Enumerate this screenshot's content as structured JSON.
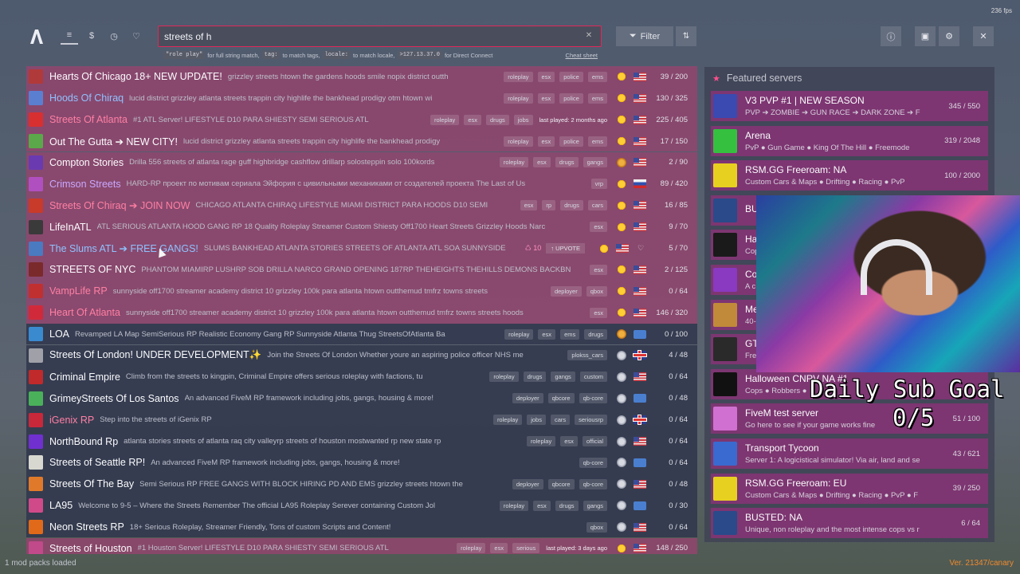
{
  "fps": "236 fps",
  "nav": {
    "icons": [
      "list-icon",
      "dollar-icon",
      "history-icon",
      "heart-icon"
    ]
  },
  "search": {
    "value": "streets of h",
    "placeholder": ""
  },
  "hints": {
    "code1": "\"role play\"",
    "text1": "for full string match,",
    "code2": "tag:",
    "text2": "to match tags,",
    "code3": "locale:",
    "text3": "to match locale,",
    "code4": ">127.13.37.0",
    "text4": "for Direct Connect",
    "cheat": "Cheat sheet"
  },
  "toolbar": {
    "filter_label": "Filter"
  },
  "servers": [
    {
      "name": "Hearts Of Chicago 18+ NEW UPDATE!",
      "desc": "grizzley streets htown the gardens hoods smile nopix district outth",
      "tags": [
        "roleplay",
        "esx",
        "police",
        "ems"
      ],
      "players": "39 / 200",
      "flag": "us",
      "weather": "sun",
      "style": "pink",
      "nameColor": "",
      "icon": "#b03a3a"
    },
    {
      "name": "Hoods Of Chiraq",
      "desc": "lucid district grizzley atlanta streets trappin city highlife the bankhead prodigy otm htown wi",
      "tags": [
        "roleplay",
        "esx",
        "police",
        "ems"
      ],
      "players": "130 / 325",
      "flag": "us",
      "weather": "sun",
      "style": "pink",
      "nameColor": "blue",
      "icon": "#5a7fd0"
    },
    {
      "name": "Streets Of Atlanta",
      "desc": "#1 ATL Server! LIFESTYLE D10 PARA SHIESTY SEMI SERIOUS ATL",
      "tags": [
        "roleplay",
        "esx",
        "drugs",
        "jobs"
      ],
      "lastPlayed": "last played: 2 months ago",
      "players": "225 / 405",
      "flag": "us",
      "weather": "sun",
      "style": "pink",
      "nameColor": "red",
      "icon": "#d83030"
    },
    {
      "name": "Out The Gutta ➔ NEW CITY!",
      "desc": "lucid district grizzley atlanta streets trappin city highlife the bankhead prodigy",
      "tags": [
        "roleplay",
        "esx",
        "police",
        "ems"
      ],
      "players": "17 / 150",
      "flag": "us",
      "weather": "sun",
      "style": "pink",
      "nameColor": "",
      "icon": "#5aa84a"
    },
    {
      "name": "Compton Stories",
      "desc": "Drilla 556 streets of atlanta rage guff highbridge cashflow drillarp solosteppin solo 100kords",
      "tags": [
        "roleplay",
        "esx",
        "drugs",
        "gangs"
      ],
      "players": "2 / 90",
      "flag": "us",
      "weather": "moon",
      "style": "pink",
      "nameColor": "",
      "icon": "#6a3ab0"
    },
    {
      "name": "Crimson Streets",
      "desc": "HARD-RP проект по мотивам сериала Эйфория с цивильными механиками от создателей проекта The Last of Us",
      "tags": [
        "vrp"
      ],
      "players": "89 / 420",
      "flag": "ru",
      "weather": "sun",
      "style": "pink",
      "nameColor": "violet",
      "icon": "#b050c0"
    },
    {
      "name": "Streets Of Chiraq ➔ JOIN NOW",
      "desc": "CHICAGO ATLANTA CHIRAQ LIFESTYLE MIAMI DISTRICT PARA HOODS D10 SEMI",
      "tags": [
        "esx",
        "rp",
        "drugs",
        "cars"
      ],
      "players": "16 / 85",
      "flag": "us",
      "weather": "sun",
      "style": "pink",
      "nameColor": "red",
      "icon": "#c83a2a"
    },
    {
      "name": "LifeInATL",
      "desc": "ATL SERIOUS ATLANTA HOOD GANG RP 18 Quality Roleplay Streamer Custom Shiesty Off1700 Heart Streets Grizzley Hoods Narc",
      "tags": [
        "esx"
      ],
      "players": "9 / 70",
      "flag": "us",
      "weather": "sun",
      "style": "pink",
      "nameColor": "",
      "icon": "#3a3a3a"
    },
    {
      "name": "The Slums ATL ➔ FREE GANGS!",
      "desc": "SLUMS BANKHEAD ATLANTA STORIES STREETS OF ATLANTA ATL SOA SUNNYSIDE",
      "tags": [],
      "boost": "10",
      "upvote": "UPVOTE",
      "heart": true,
      "players": "5 / 70",
      "flag": "us",
      "weather": "sun",
      "style": "pink",
      "nameColor": "blue",
      "icon": "#4a7ac0"
    },
    {
      "name": "STREETS OF NYC",
      "desc": "PHANTOM MIAMIRP LUSHRP SOB DRILLA NARCO GRAND OPENING 187RP THEHEIGHTS THEHILLS DEMONS BACKBN",
      "tags": [
        "esx"
      ],
      "players": "2 / 125",
      "flag": "us",
      "weather": "sun",
      "style": "pink",
      "nameColor": "",
      "icon": "#7a2a2a"
    },
    {
      "name": "VampLife RP",
      "desc": "sunnyside off1700 streamer academy district 10 grizzley 100k para atlanta htown outthemud tmfrz towns streets",
      "tags": [
        "deployer",
        "qbox"
      ],
      "players": "0 / 64",
      "flag": "us",
      "weather": "sun",
      "style": "pink",
      "nameColor": "red",
      "icon": "#c03030"
    },
    {
      "name": "Heart Of Atlanta",
      "desc": "sunnyside off1700 streamer academy district 10 grizzley 100k para atlanta htown outthemud tmfrz towns streets hoods",
      "tags": [
        "esx"
      ],
      "players": "146 / 320",
      "flag": "us",
      "weather": "sun",
      "style": "pink",
      "nameColor": "red",
      "icon": "#d02a3a"
    },
    {
      "name": "LOA",
      "desc": "Revamped LA Map SemiSerious RP Realistic Economy Gang RP Sunnyside Atlanta Thug StreetsOfAtlanta Ba",
      "tags": [
        "roleplay",
        "esx",
        "ems",
        "drugs"
      ],
      "players": "0 / 100",
      "flag": "globe",
      "weather": "moon",
      "style": "dark",
      "nameColor": "",
      "icon": "#3a8ad0"
    },
    {
      "name": "Streets Of London! UNDER DEVELOPMENT✨",
      "desc": "Join the Streets Of London Whether youre an aspiring police officer NHS me",
      "tags": [
        "plokss_cars"
      ],
      "players": "4 / 48",
      "flag": "gb",
      "weather": "night",
      "style": "dark",
      "nameColor": "",
      "icon": "#a0a0a8"
    },
    {
      "name": "Criminal Empire",
      "desc": "Climb from the streets to kingpin, Criminal Empire offers serious roleplay with factions, tu",
      "tags": [
        "roleplay",
        "drugs",
        "gangs",
        "custom"
      ],
      "players": "0 / 64",
      "flag": "us",
      "weather": "night",
      "style": "dark",
      "nameColor": "",
      "icon": "#c02a2a"
    },
    {
      "name": "GrimeyStreets Of Los Santos",
      "desc": "An advanced FiveM RP framework including jobs, gangs, housing & more!",
      "tags": [
        "deployer",
        "qbcore",
        "qb-core"
      ],
      "players": "0 / 48",
      "flag": "globe",
      "weather": "night",
      "style": "dark",
      "nameColor": "",
      "icon": "#4ab05a"
    },
    {
      "name": "iGenix RP",
      "desc": "Step into the streets of iGenix RP",
      "tags": [
        "roleplay",
        "jobs",
        "cars",
        "seriousrp"
      ],
      "players": "0 / 64",
      "flag": "gb",
      "weather": "night",
      "style": "dark",
      "nameColor": "red",
      "icon": "#c8283a"
    },
    {
      "name": "NorthBound Rp",
      "desc": "atlanta stories streets of atlanta raq city valleyrp streets of houston mostwanted rp new state rp",
      "tags": [
        "roleplay",
        "esx",
        "official"
      ],
      "players": "0 / 64",
      "flag": "us",
      "weather": "night",
      "style": "dark",
      "nameColor": "",
      "icon": "#7030d0"
    },
    {
      "name": "Streets of Seattle RP!",
      "desc": "An advanced FiveM RP framework including jobs, gangs, housing & more!",
      "tags": [
        "qb-core"
      ],
      "players": "0 / 64",
      "flag": "globe",
      "weather": "night",
      "style": "dark",
      "nameColor": "",
      "icon": "#d8d8d0"
    },
    {
      "name": "Streets Of The Bay",
      "desc": "Semi Serious RP FREE GANGS WITH BLOCK HIRING PD AND EMS grizzley streets htown the",
      "tags": [
        "deployer",
        "qbcore",
        "qb-core"
      ],
      "players": "0 / 48",
      "flag": "us",
      "weather": "night",
      "style": "dark",
      "nameColor": "",
      "icon": "#e07a2a"
    },
    {
      "name": "LA95",
      "desc": "Welcome to 9-5 – Where the Streets Remember The official LA95 Roleplay Serever containing Custom Jol",
      "tags": [
        "roleplay",
        "esx",
        "drugs",
        "gangs"
      ],
      "players": "0 / 30",
      "flag": "globe",
      "weather": "night",
      "style": "dark",
      "nameColor": "",
      "icon": "#d04a8a"
    },
    {
      "name": "Neon Streets RP",
      "desc": "18+ Serious Roleplay, Streamer Friendly, Tons of custom Scripts and Content!",
      "tags": [
        "qbox"
      ],
      "players": "0 / 64",
      "flag": "us",
      "weather": "night",
      "style": "dark",
      "nameColor": "",
      "icon": "#e06a1a"
    },
    {
      "name": "Streets of Houston",
      "desc": "#1 Houston Server! LIFESTYLE D10 PARA SHIESTY SEMI SERIOUS ATL",
      "tags": [
        "roleplay",
        "esx",
        "serious"
      ],
      "lastPlayed": "last played: 3 days ago",
      "players": "148 / 250",
      "flag": "us",
      "weather": "sun",
      "style": "pink",
      "nameColor": "",
      "icon": "#c04a8a"
    }
  ],
  "featured": {
    "title": "Featured servers",
    "items": [
      {
        "title": "V3 PVP #1  |  NEW SEASON",
        "desc": "PVP ➔ ZOMBIE ➔ GUN RACE ➔ DARK ZONE ➔ F",
        "players": "345 / 550",
        "icon": "#3a4ab0"
      },
      {
        "title": "Arena",
        "desc": "PvP ● Gun Game ● King Of The Hill ● Freemode",
        "players": "319 / 2048",
        "icon": "#35c040"
      },
      {
        "title": "RSM.GG Freeroam: NA",
        "desc": "Custom Cars & Maps ● Drifting ● Racing ● PvP",
        "players": "100 / 2000",
        "icon": "#e8d020"
      },
      {
        "title": "BU",
        "desc": "",
        "players": "",
        "icon": "#2a4a8a"
      },
      {
        "title": "Ha",
        "desc": "Cop",
        "players": "",
        "icon": "#1a1a1a"
      },
      {
        "title": "Co",
        "desc": "A c",
        "players": "",
        "icon": "#8a3ac0"
      },
      {
        "title": "Me",
        "desc": "40-",
        "players": "",
        "icon": "#c08a3a"
      },
      {
        "title": "GT",
        "desc": "Fre",
        "players": "",
        "icon": "#2a2a2a"
      },
      {
        "title": "Halloween CNRV NA #1",
        "desc": "Cops ● Robbers ●",
        "players": "",
        "icon": "#111111"
      },
      {
        "title": "FiveM test server",
        "desc": "Go here to see if your game works fine",
        "players": "51 / 100",
        "icon": "#d070d0"
      },
      {
        "title": "Transport Tycoon",
        "desc": "Server 1: A logicistical simulator! Via air, land and se",
        "players": "43 / 621",
        "icon": "#3a6ad0"
      },
      {
        "title": "RSM.GG Freeroam: EU",
        "desc": "Custom Cars & Maps ● Drifting ● Racing ● PvP ● F",
        "players": "39 / 250",
        "icon": "#e8d020"
      },
      {
        "title": "BUSTED: NA",
        "desc": "Unique, non roleplay and the most intense cops vs r",
        "players": "6 / 64",
        "icon": "#2a4a8a"
      }
    ]
  },
  "overlay": {
    "goal_label": "Daily Sub Goal",
    "goal_count": "0/5"
  },
  "footer": {
    "left": "1 mod packs loaded",
    "right": "Ver. 21347/canary"
  }
}
